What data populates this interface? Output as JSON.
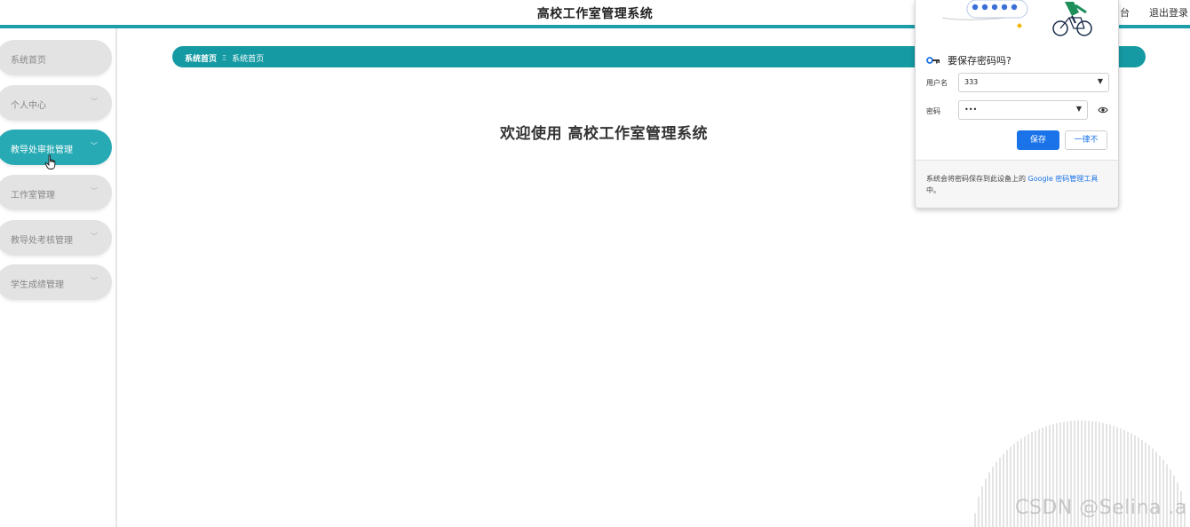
{
  "header": {
    "title": "高校工作室管理系统",
    "right_partial": "台",
    "logout": "退出登录"
  },
  "sidebar": {
    "items": [
      {
        "label": "系统首页",
        "has_chevron": false
      },
      {
        "label": "个人中心",
        "has_chevron": true
      },
      {
        "label": "教导处审批管理",
        "has_chevron": true,
        "active": true
      },
      {
        "label": "工作室管理",
        "has_chevron": true
      },
      {
        "label": "教导处考核管理",
        "has_chevron": true
      },
      {
        "label": "学生成绩管理",
        "has_chevron": true
      }
    ]
  },
  "breadcrumb": {
    "home": "系统首页",
    "separator": "Ξ",
    "current": "系统首页"
  },
  "main": {
    "welcome": "欢迎使用 高校工作室管理系统"
  },
  "password_popup": {
    "title": "要保存密码吗?",
    "username_label": "用户名",
    "username_value": "333",
    "password_label": "密码",
    "password_value": "•••",
    "save_label": "保存",
    "never_label": "一律不",
    "footer_prefix": "系统会将密码保存到此设备上的 ",
    "footer_link": "Google 密码管理工具",
    "footer_suffix": "中。"
  },
  "watermark": {
    "text": "CSDN @Selina .a"
  },
  "colors": {
    "accent": "#1e9ea8",
    "menu_active": "#27aab4",
    "menu_inactive": "#e3e3e3",
    "google_blue": "#1a73e8"
  },
  "icons": [
    "key-icon",
    "dropdown-caret-icon",
    "eye-icon",
    "chevron-down-icon",
    "hand-cursor-icon",
    "cyclist-illustration"
  ]
}
